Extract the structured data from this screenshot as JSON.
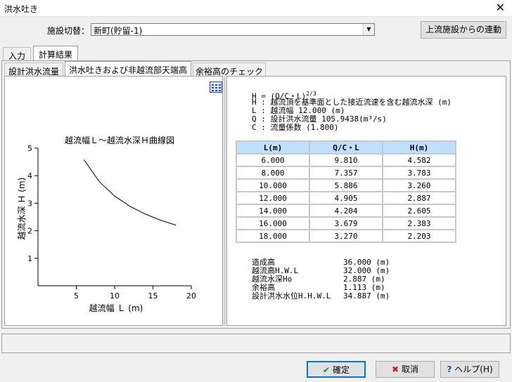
{
  "window": {
    "title": "洪水吐き"
  },
  "facility": {
    "label": "施設切替：",
    "value": "新町(貯留-1)"
  },
  "buttons": {
    "upstream_link": "上流施設からの連動",
    "ok": "確定",
    "cancel": "取消",
    "help": "ヘルプ(H)"
  },
  "tabs_main": [
    {
      "label": "入力"
    },
    {
      "label": "計算結果"
    }
  ],
  "tabs_sub": [
    {
      "label": "設計洪水流量"
    },
    {
      "label": "洪水吐きおよび非越流部天端高"
    },
    {
      "label": "余裕高のチェック"
    }
  ],
  "formulas": {
    "f1": "H = (Q/C・L)",
    "f1_exp": "2/3",
    "f2": "H : 越流頂を基準面とした接近流速を含む越流水深 (m)",
    "f3": "L : 越流幅 12.000 (m)",
    "f4": "Q : 設計洪水流量 105.9438(m³/s)",
    "f5": "C : 流量係数 (1.800)"
  },
  "table": {
    "headers": [
      "L(m)",
      "Q/C・L",
      "H(m)"
    ],
    "rows": [
      [
        "6.000",
        "9.810",
        "4.582"
      ],
      [
        "8.000",
        "7.357",
        "3.783"
      ],
      [
        "10.000",
        "5.886",
        "3.260"
      ],
      [
        "12.000",
        "4.905",
        "2.887"
      ],
      [
        "14.000",
        "4.204",
        "2.605"
      ],
      [
        "16.000",
        "3.679",
        "2.383"
      ],
      [
        "18.000",
        "3.270",
        "2.203"
      ]
    ]
  },
  "summary": [
    {
      "label": "造成高",
      "value": "36.000 (m)"
    },
    {
      "label": "越流高H.W.L",
      "value": "32.000 (m)"
    },
    {
      "label": "越流水深Ho",
      "value": "2.887 (m)"
    },
    {
      "label": "余裕高",
      "value": "1.113 (m)"
    },
    {
      "label": "設計洪水水位H.H.W.L",
      "value": "34.887 (m)"
    }
  ],
  "chart_data": {
    "type": "line",
    "title": "越流幅Ｌ～越流水深Ｈ曲線図",
    "xlabel": "越流幅 Ｌ (m)",
    "ylabel": "越流水深 Ｈ (m)",
    "xlim": [
      0,
      20
    ],
    "ylim": [
      0,
      5
    ],
    "xticks": [
      5,
      10,
      15,
      20
    ],
    "yticks": [
      1,
      2,
      3,
      4,
      5
    ],
    "series": [
      {
        "x": [
          6,
          8,
          10,
          12,
          14,
          16,
          18
        ],
        "y": [
          4.582,
          3.783,
          3.26,
          2.887,
          2.605,
          2.383,
          2.203
        ]
      }
    ],
    "grid": false
  }
}
